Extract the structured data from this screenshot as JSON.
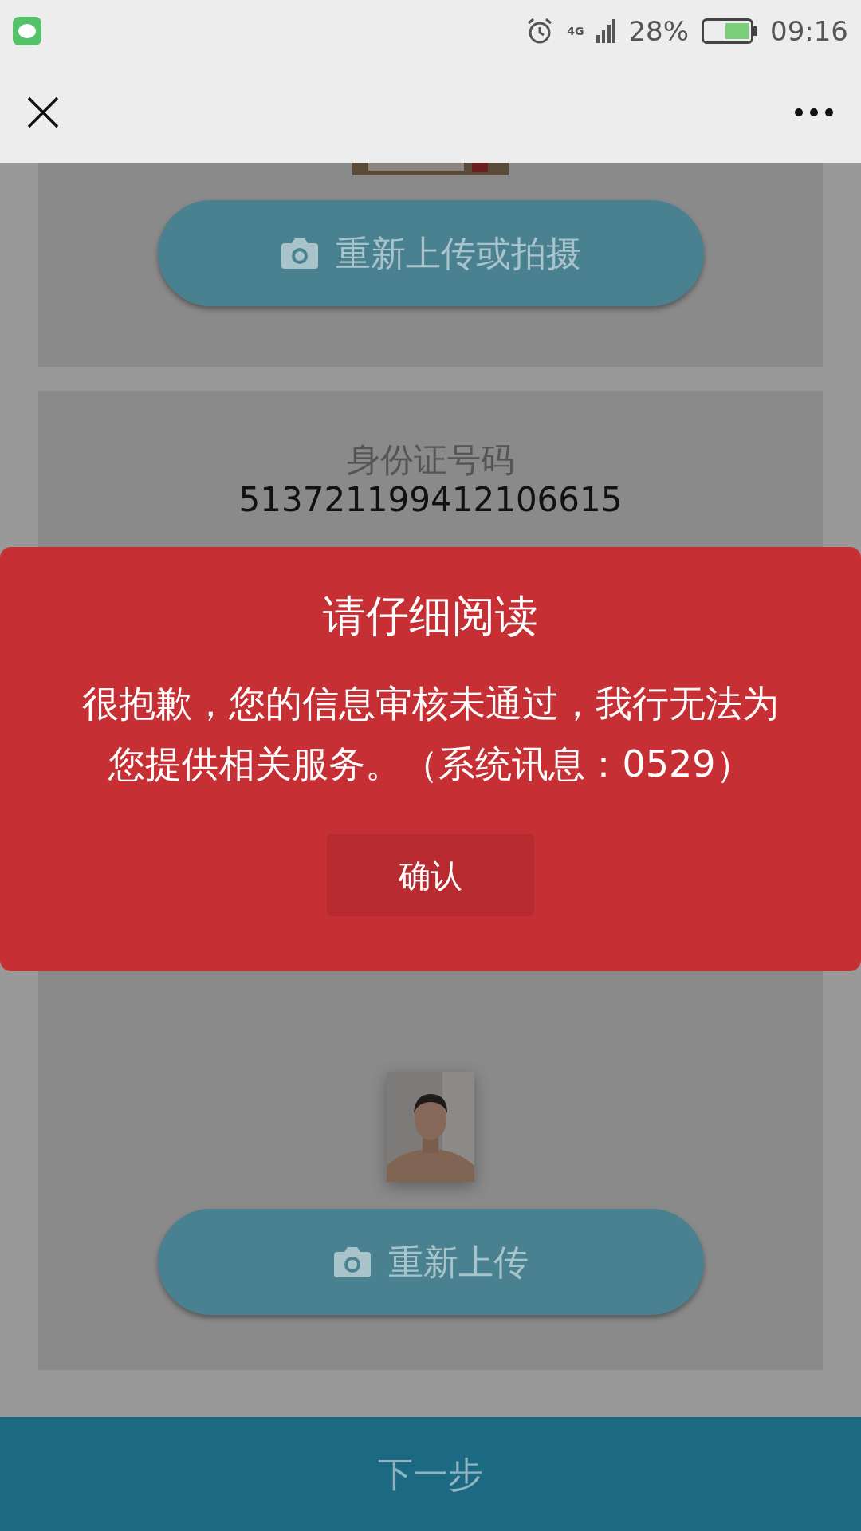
{
  "status_bar": {
    "battery": "28%",
    "time": "09:16",
    "network": "4G"
  },
  "sections": [
    {
      "kind": "upload",
      "button": "重新上传或拍摄"
    },
    {
      "kind": "id",
      "label": "身份证号码",
      "value": "513721199412106615"
    },
    {
      "kind": "avatar",
      "button": "重新上传"
    }
  ],
  "dialog": {
    "title": "请仔细阅读",
    "message": "很抱歉，您的信息审核未通过，我行无法为您提供相关服务。（系统讯息：0529）",
    "button": "确认"
  },
  "footer": {
    "button": "下一步"
  }
}
